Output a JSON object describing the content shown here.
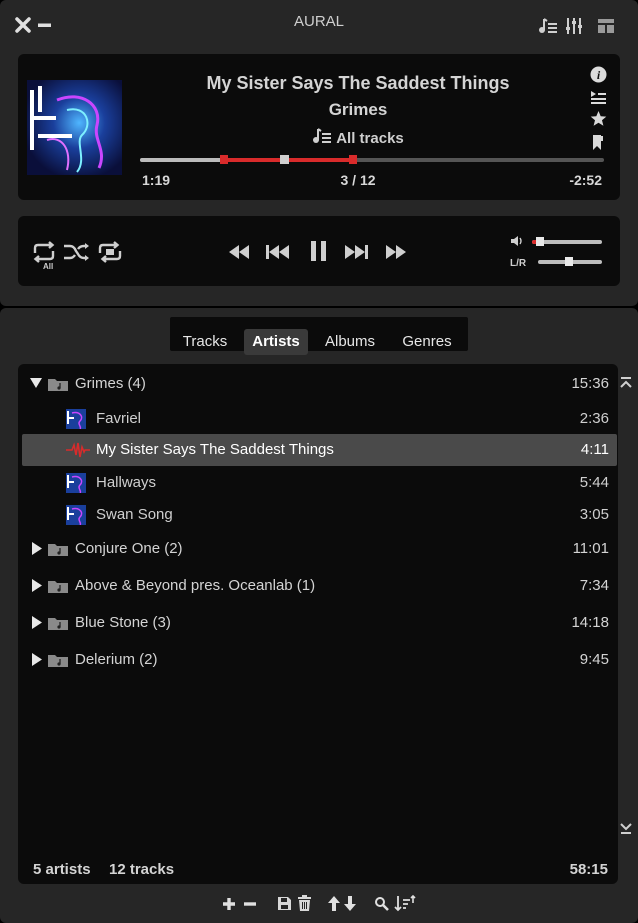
{
  "app": {
    "title": "AURAL"
  },
  "now_playing": {
    "title": "My Sister Says The Saddest Things",
    "artist": "Grimes",
    "playlist": "All tracks",
    "elapsed": "1:19",
    "position": "3 / 12",
    "remaining": "-2:52",
    "progress_fraction": 0.31,
    "loop_segment": [
      0.18,
      0.46
    ]
  },
  "controls": {
    "repeat_mode": "All",
    "volume_fraction": 0.12,
    "balance_label": "L/R",
    "balance_fraction": 0.48
  },
  "tabs": [
    {
      "label": "Tracks",
      "active": false
    },
    {
      "label": "Artists",
      "active": true
    },
    {
      "label": "Albums",
      "active": false
    },
    {
      "label": "Genres",
      "active": false
    }
  ],
  "groups": [
    {
      "name": "Grimes (4)",
      "duration": "15:36",
      "expanded": true,
      "tracks": [
        {
          "name": "Favriel",
          "duration": "2:36",
          "playing": false
        },
        {
          "name": "My Sister Says The Saddest Things",
          "duration": "4:11",
          "playing": true
        },
        {
          "name": "Hallways",
          "duration": "5:44",
          "playing": false
        },
        {
          "name": "Swan Song",
          "duration": "3:05",
          "playing": false
        }
      ]
    },
    {
      "name": "Conjure One (2)",
      "duration": "11:01",
      "expanded": false,
      "tracks": []
    },
    {
      "name": "Above & Beyond pres. Oceanlab (1)",
      "duration": "7:34",
      "expanded": false,
      "tracks": []
    },
    {
      "name": "Blue Stone (3)",
      "duration": "14:18",
      "expanded": false,
      "tracks": []
    },
    {
      "name": "Delerium (2)",
      "duration": "9:45",
      "expanded": false,
      "tracks": []
    }
  ],
  "summary": {
    "artists": "5 artists",
    "tracks": "12 tracks",
    "total": "58:15"
  },
  "colors": {
    "accent_red": "#d92b2b",
    "background": "#262626",
    "panel": "#0b0b0b"
  }
}
